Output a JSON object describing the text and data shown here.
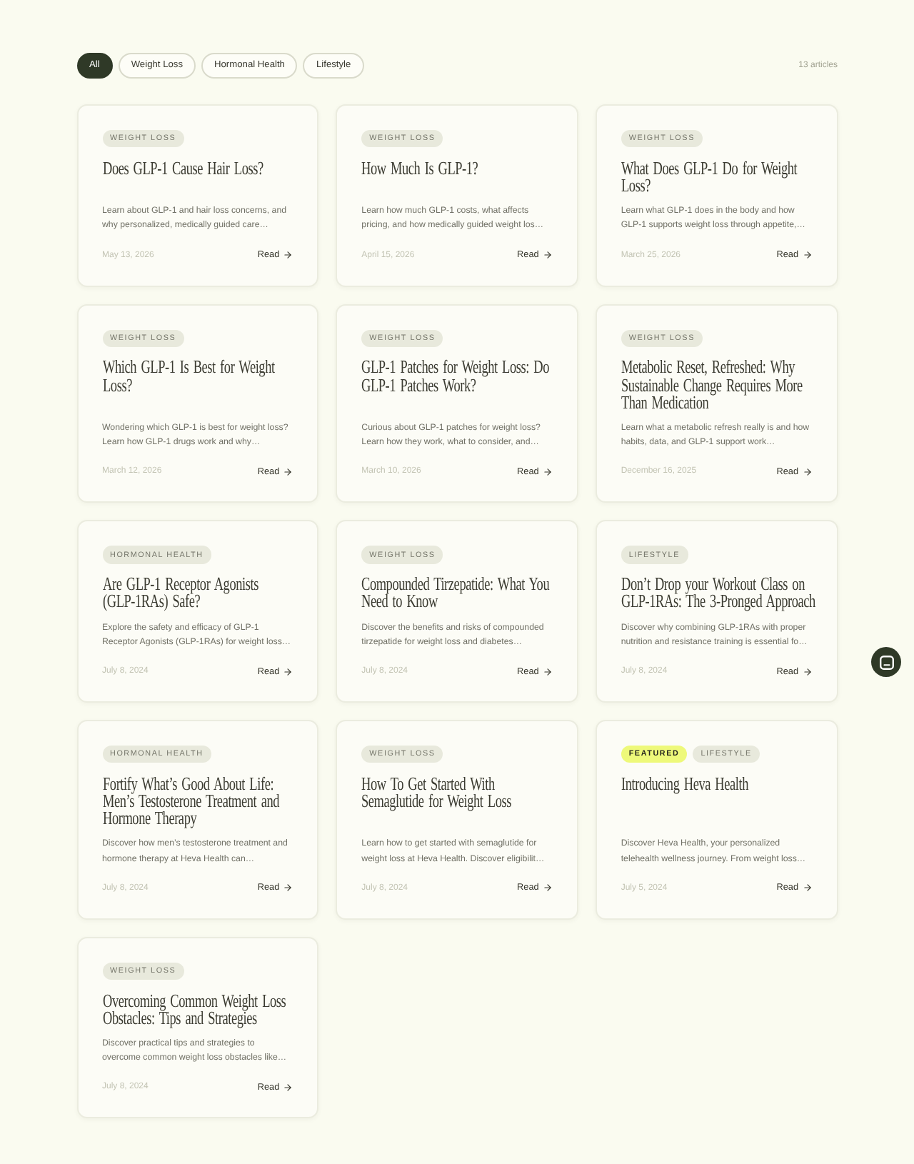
{
  "filters": [
    {
      "label": "All",
      "selected": true
    },
    {
      "label": "Weight Loss",
      "selected": false
    },
    {
      "label": "Hormonal Health",
      "selected": false
    },
    {
      "label": "Lifestyle",
      "selected": false
    }
  ],
  "article_count": "13 articles",
  "articles": [
    {
      "tags": [
        {
          "label": "WEIGHT LOSS",
          "kind": "category"
        }
      ],
      "title": "Does GLP-1 Cause Hair Loss?",
      "excerpt": "Learn about GLP-1 and hair loss concerns, and why personalized, medically guided care…",
      "date": "May 13, 2026",
      "link": "Read"
    },
    {
      "tags": [
        {
          "label": "WEIGHT LOSS",
          "kind": "category"
        }
      ],
      "title": "How Much Is GLP-1?",
      "excerpt": "Learn how much GLP-1 costs, what affects pricing, and how medically guided weight los…",
      "date": "April 15, 2026",
      "link": "Read"
    },
    {
      "tags": [
        {
          "label": "WEIGHT LOSS",
          "kind": "category"
        }
      ],
      "title": "What Does GLP-1 Do for Weight Loss?",
      "excerpt": "Learn what GLP-1 does in the body and how GLP-1 supports weight loss through appetite,…",
      "date": "March 25, 2026",
      "link": "Read"
    },
    {
      "tags": [
        {
          "label": "WEIGHT LOSS",
          "kind": "category"
        }
      ],
      "title": "Which GLP-1 Is Best for Weight Loss?",
      "excerpt": "Wondering which GLP-1 is best for weight loss? Learn how GLP-1 drugs work and why…",
      "date": "March 12, 2026",
      "link": "Read"
    },
    {
      "tags": [
        {
          "label": "WEIGHT LOSS",
          "kind": "category"
        }
      ],
      "title": "GLP-1 Patches for Weight Loss: Do GLP-1 Patches Work?",
      "excerpt": "Curious about GLP-1 patches for weight loss? Learn how they work, what to consider, and…",
      "date": "March 10, 2026",
      "link": "Read"
    },
    {
      "tags": [
        {
          "label": "WEIGHT LOSS",
          "kind": "category"
        }
      ],
      "title": "Metabolic Reset, Refreshed: Why Sustainable Change Requires More Than Medication",
      "excerpt": "Learn what a metabolic refresh really is and how habits, data, and GLP-1 support work…",
      "date": "December 16, 2025",
      "link": "Read"
    },
    {
      "tags": [
        {
          "label": "HORMONAL HEALTH",
          "kind": "category"
        }
      ],
      "title": "Are GLP-1 Receptor Agonists (GLP-1RAs) Safe?",
      "excerpt": "Explore the safety and efficacy of GLP-1 Receptor Agonists (GLP-1RAs) for weight loss…",
      "date": "July 8, 2024",
      "link": "Read"
    },
    {
      "tags": [
        {
          "label": "WEIGHT LOSS",
          "kind": "category"
        }
      ],
      "title": "Compounded Tirzepatide: What You Need to Know",
      "excerpt": "Discover the benefits and risks of compounded tirzepatide for weight loss and diabetes…",
      "date": "July 8, 2024",
      "link": "Read"
    },
    {
      "tags": [
        {
          "label": "LIFESTYLE",
          "kind": "category"
        }
      ],
      "title": "Don’t Drop your Workout Class on GLP-1RAs: The 3-Pronged Approach",
      "excerpt": "Discover why combining GLP-1RAs with proper nutrition and resistance training is essential fo…",
      "date": "July 8, 2024",
      "link": "Read"
    },
    {
      "tags": [
        {
          "label": "HORMONAL HEALTH",
          "kind": "category"
        }
      ],
      "title": "Fortify What’s Good About Life: Men’s Testosterone Treatment and Hormone Therapy",
      "excerpt": "Discover how men’s testosterone treatment and hormone therapy at Heva Health can…",
      "date": "July 8, 2024",
      "link": "Read"
    },
    {
      "tags": [
        {
          "label": "WEIGHT LOSS",
          "kind": "category"
        }
      ],
      "title": "How To Get Started With Semaglutide for Weight Loss",
      "excerpt": "Learn how to get started with semaglutide for weight loss at Heva Health. Discover eligibilit…",
      "date": "July 8, 2024",
      "link": "Read"
    },
    {
      "tags": [
        {
          "label": "FEATURED",
          "kind": "featured"
        },
        {
          "label": "LIFESTYLE",
          "kind": "category"
        }
      ],
      "title": "Introducing Heva Health",
      "excerpt": "Discover Heva Health, your personalized telehealth wellness journey. From weight loss…",
      "date": "July 5, 2024",
      "link": "Read"
    },
    {
      "tags": [
        {
          "label": "WEIGHT LOSS",
          "kind": "category"
        }
      ],
      "title": "Overcoming Common Weight Loss Obstacles: Tips and Strategies",
      "excerpt": "Discover practical tips and strategies to overcome common weight loss obstacles like…",
      "date": "July 8, 2024",
      "link": "Read"
    }
  ]
}
